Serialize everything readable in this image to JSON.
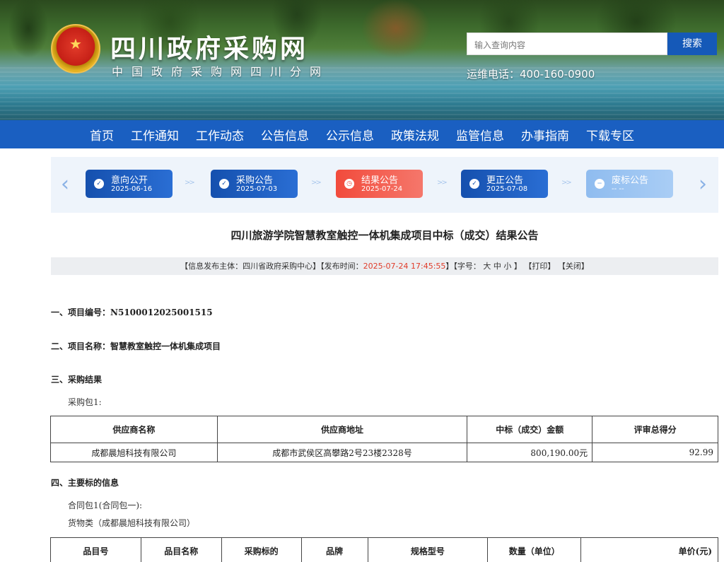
{
  "header": {
    "site_title": "四川政府采购网",
    "site_subtitle": "中国政府采购网四川分网",
    "search_placeholder": "输入查询内容",
    "search_button": "搜索",
    "hotline": "运维电话：400-160-0900"
  },
  "nav": {
    "items": [
      {
        "label": "首页"
      },
      {
        "label": "工作通知"
      },
      {
        "label": "工作动态"
      },
      {
        "label": "公告信息"
      },
      {
        "label": "公示信息"
      },
      {
        "label": "政策法规"
      },
      {
        "label": "监管信息"
      },
      {
        "label": "办事指南"
      },
      {
        "label": "下载专区"
      }
    ]
  },
  "steps": {
    "items": [
      {
        "label": "意向公开",
        "date": "2025-06-16",
        "state": "done"
      },
      {
        "label": "采购公告",
        "date": "2025-07-03",
        "state": "done"
      },
      {
        "label": "结果公告",
        "date": "2025-07-24",
        "state": "current"
      },
      {
        "label": "更正公告",
        "date": "2025-07-08",
        "state": "done"
      },
      {
        "label": "废标公告",
        "date": "-- --",
        "state": "disabled"
      }
    ],
    "arrow_left": "‹",
    "arrow_right": "›"
  },
  "article": {
    "title": "四川旅游学院智慧教室触控一体机集成项目中标（成交）结果公告",
    "info": {
      "publisher_prefix": "【信息发布主体：四川省政府采购中心】【发布时间：",
      "publish_time": "2025-07-24 17:45:55",
      "font_prefix": "】【字号：",
      "font_large": "大",
      "font_medium": "中",
      "font_small": "小",
      "font_suffix": "】",
      "print": "【打印】",
      "close": "【关闭】"
    },
    "section1": "一、项目编号：N5100012025001515",
    "section2": "二、项目名称：智慧教室触控一体机集成项目",
    "section3": "三、采购结果",
    "package1": "采购包1:",
    "result_table": {
      "headers": [
        "供应商名称",
        "供应商地址",
        "中标（成交）金额",
        "评审总得分"
      ],
      "rows": [
        [
          "成都晨旭科技有限公司",
          "成都市武侯区高攀路2号23楼2328号",
          "800,190.00元",
          "92.99"
        ]
      ]
    },
    "section4": "四、主要标的信息",
    "contract_package": "合同包1(合同包一):",
    "goods_type": "货物类（成都晨旭科技有限公司）",
    "items_table": {
      "headers": [
        "品目号",
        "品目名称",
        "采购标的",
        "品牌",
        "规格型号",
        "数量（单位）",
        "单价(元)"
      ]
    }
  }
}
